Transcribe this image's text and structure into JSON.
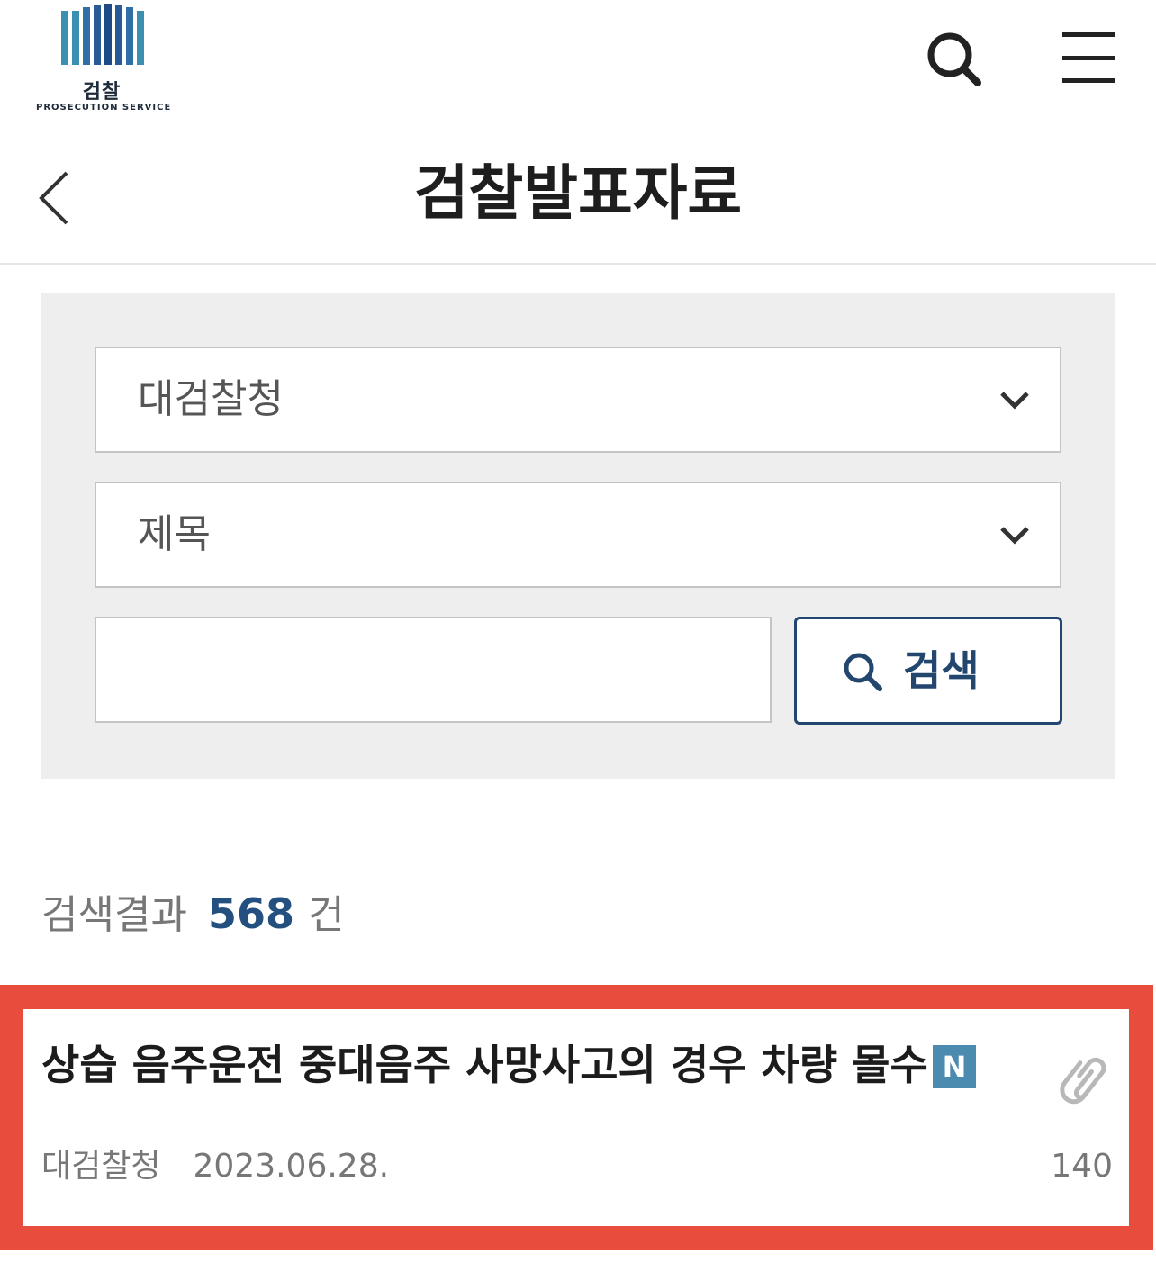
{
  "header": {
    "logo_text": "검찰",
    "logo_subtitle": "PROSECUTION SERVICE",
    "logo_colors": [
      "#3b8fb0",
      "#3b8fb0",
      "#2f6fa6",
      "#2a5a95",
      "#1e4a86",
      "#2a5a95",
      "#2f6fa6",
      "#3b8fb0"
    ],
    "search_icon": "search-icon",
    "menu_icon": "hamburger-menu-icon"
  },
  "title_bar": {
    "back_icon": "chevron-left-icon",
    "title": "검찰발표자료"
  },
  "search": {
    "org_select_value": "대검찰청",
    "field_select_value": "제목",
    "keyword_value": "",
    "keyword_placeholder": "",
    "button_label": "검색",
    "button_icon": "search-icon",
    "accent_color": "#23466e"
  },
  "results": {
    "label": "검색결과",
    "count": "568",
    "unit": "건"
  },
  "list": {
    "items": [
      {
        "title": "상습 음주운전 중대음주 사망사고의 경우 차량 몰수",
        "badge": "N",
        "has_attachment": true,
        "attachment_icon": "paperclip-icon",
        "org": "대검찰청",
        "date": "2023.06.28.",
        "views": "140"
      }
    ]
  },
  "highlight_color": "#e74c3c"
}
